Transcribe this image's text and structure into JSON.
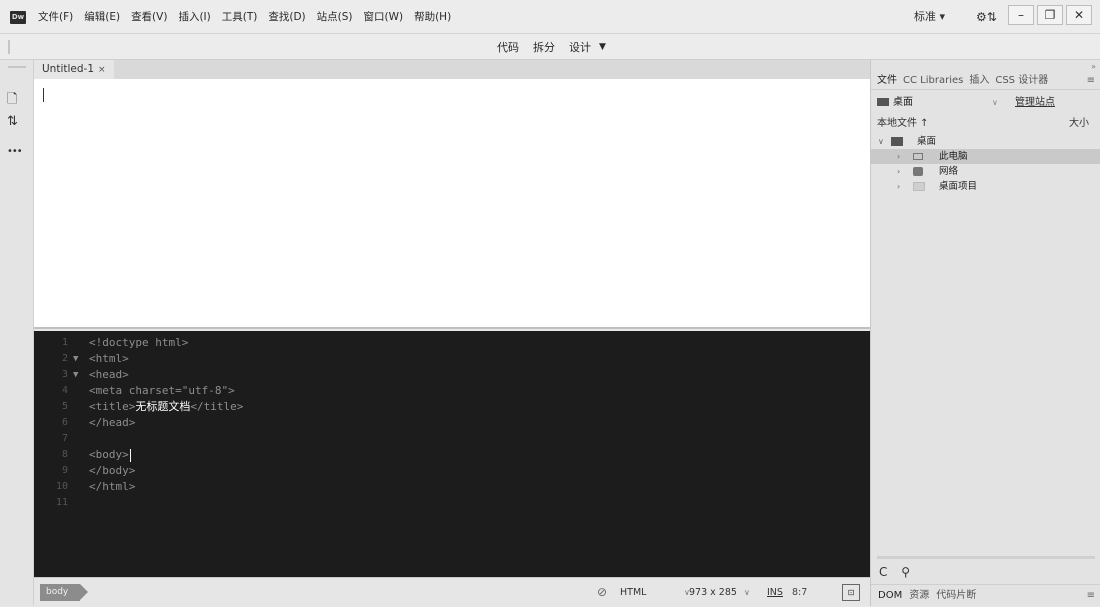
{
  "app": {
    "icon_text": "Dw"
  },
  "menubar": {
    "items": [
      "文件(F)",
      "编辑(E)",
      "查看(V)",
      "插入(I)",
      "工具(T)",
      "查找(D)",
      "站点(S)",
      "窗口(W)",
      "帮助(H)"
    ],
    "workspace": "标准 ▾",
    "sync_icon": "⚙⇅",
    "window_controls": [
      "–",
      "❐",
      "✕"
    ]
  },
  "viewbar": {
    "code": "代码",
    "split": "拆分",
    "design": "设计",
    "design_arrow": "▼"
  },
  "tools": {
    "file_icon": "🗋",
    "sort_icon": "⇅",
    "more_icon": "•••"
  },
  "document": {
    "tab_title": "Untitled-1",
    "tab_close": "×"
  },
  "code_lines": [
    {
      "n": "1",
      "fold": "",
      "text": "<!doctype html>"
    },
    {
      "n": "2",
      "fold": "▼",
      "text": "<html>"
    },
    {
      "n": "3",
      "fold": "▼",
      "text": "<head>"
    },
    {
      "n": "4",
      "fold": "",
      "text": "<meta charset=\"utf-8\">"
    },
    {
      "n": "5",
      "fold": "",
      "pre": "<title>",
      "strong": "无标题文档",
      "post": "</title>"
    },
    {
      "n": "6",
      "fold": "",
      "text": "</head>"
    },
    {
      "n": "7",
      "fold": "",
      "text": ""
    },
    {
      "n": "8",
      "fold": "",
      "text": "<body>"
    },
    {
      "n": "9",
      "fold": "",
      "text": "</body>"
    },
    {
      "n": "10",
      "fold": "",
      "text": "</html>"
    },
    {
      "n": "11",
      "fold": "",
      "text": ""
    }
  ],
  "statusbar": {
    "tag": "body",
    "check_icon": "⊘",
    "doctype": "HTML",
    "doctype_arrow": "∨",
    "size": "973 x 285",
    "size_arrow": "∨",
    "ins": "INS",
    "position": "8:7",
    "preview_icon": "⊡"
  },
  "panel": {
    "tabs": [
      "文件",
      "CC Libraries",
      "插入",
      "CSS 设计器"
    ],
    "menu_icon": "≡",
    "site": "桌面",
    "site_arrow": "∨",
    "manage": "管理站点",
    "local_files": "本地文件 ↑",
    "size_col": "大小",
    "tree": [
      {
        "label": "桌面",
        "arrow": "∨"
      },
      {
        "label": "此电脑",
        "arrow": "›"
      },
      {
        "label": "网络",
        "arrow": "›"
      },
      {
        "label": "桌面项目",
        "arrow": "›"
      }
    ],
    "refresh_icon": "C",
    "connect_icon": "⚲",
    "bottom_tabs": [
      "DOM",
      "资源",
      "代码片断"
    ],
    "bottom_menu_icon": "≡"
  },
  "colors": {
    "code_bg": "#1c1c1c",
    "chrome_bg": "#ececec",
    "panel_bg": "#e3e3e3"
  }
}
